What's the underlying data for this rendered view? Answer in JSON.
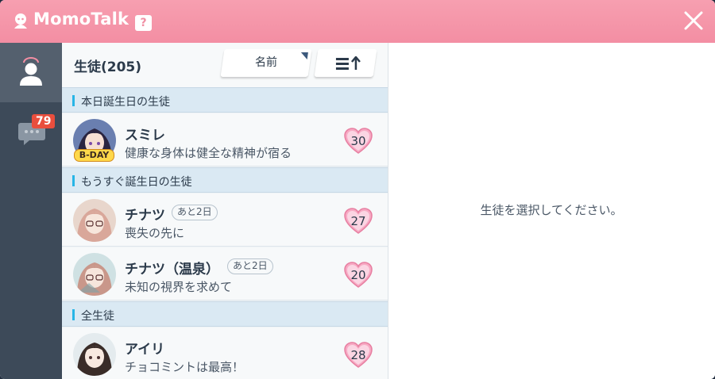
{
  "window": {
    "title": "MomoTalk",
    "help_label": "?"
  },
  "sidebar": {
    "items": [
      {
        "icon": "person-icon",
        "active": true
      },
      {
        "icon": "chat-icon",
        "badge": "79"
      }
    ]
  },
  "list": {
    "header_title": "生徒(205)",
    "sort_label": "名前",
    "order_icon": "sort-order-icon",
    "sections": [
      {
        "label": "本日誕生日の生徒"
      },
      {
        "label": "もうすぐ誕生日の生徒"
      },
      {
        "label": "全生徒"
      }
    ],
    "students": [
      {
        "name": "スミレ",
        "status": "健康な身体は健全な精神が宿る",
        "affection": "30",
        "bday_badge": "B-DAY"
      },
      {
        "name": "チナツ",
        "status": "喪失の先に",
        "affection": "27",
        "days_tag": "あと2日"
      },
      {
        "name": "チナツ（温泉）",
        "status": "未知の視界を求めて",
        "affection": "20",
        "days_tag": "あと2日"
      },
      {
        "name": "アイリ",
        "status": "チョコミントは最高！",
        "affection": "28"
      }
    ]
  },
  "detail": {
    "placeholder": "生徒を選択してください。"
  },
  "colors": {
    "titlebar": "#f38ea3",
    "sidebar": "#3d4a59",
    "badge": "#e94e3d",
    "accent": "#27b5e6",
    "heart": "#f7a9c3"
  }
}
